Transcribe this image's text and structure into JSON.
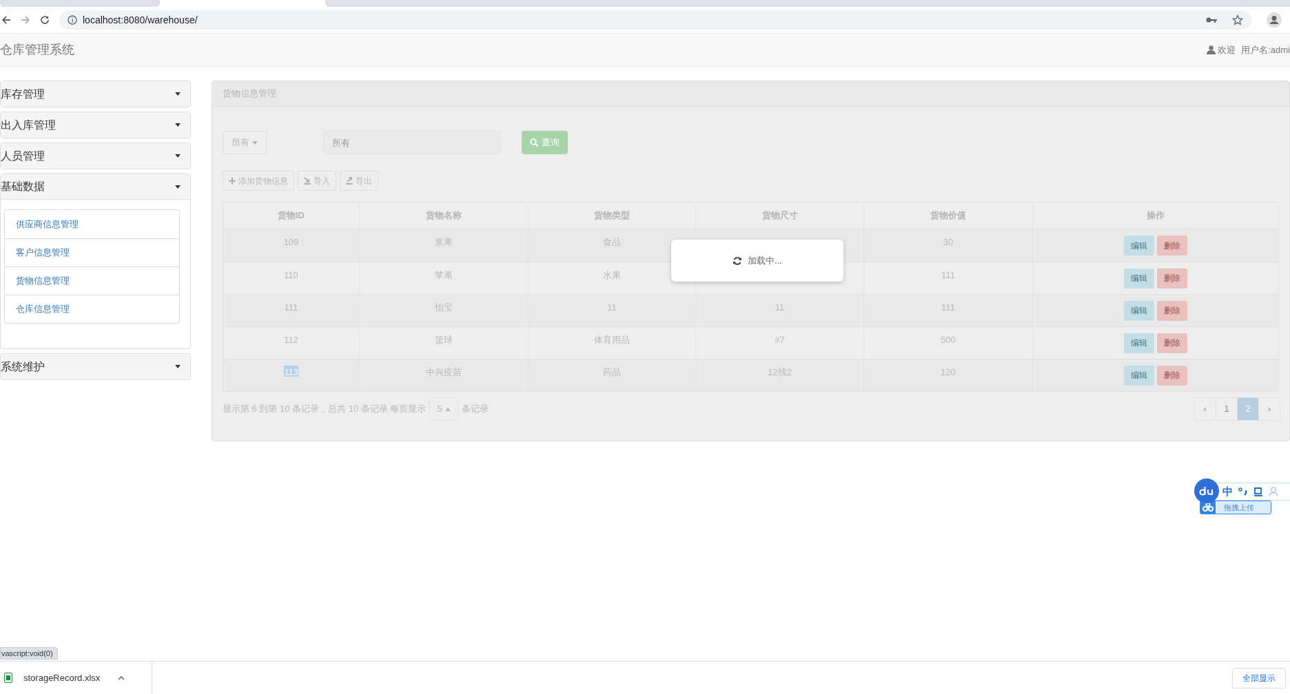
{
  "browser": {
    "url": "localhost:8080/warehouse/"
  },
  "header": {
    "title": "仓库管理系统",
    "welcome": "欢迎",
    "username": "用户名:admi"
  },
  "sidebar": [
    {
      "label": "库存管理",
      "expanded": false
    },
    {
      "label": "出入库管理",
      "expanded": false
    },
    {
      "label": "人员管理",
      "expanded": false
    },
    {
      "label": "基础数据",
      "expanded": true,
      "children": [
        {
          "label": "供应商信息管理"
        },
        {
          "label": "客户信息管理"
        },
        {
          "label": "货物信息管理"
        },
        {
          "label": "仓库信息管理"
        }
      ]
    },
    {
      "label": "系统维护",
      "expanded": false
    }
  ],
  "panel": {
    "title": "货物信息管理",
    "filter": "所有",
    "search": {
      "placeholder": "所有"
    },
    "query_button": "查询",
    "toolbar": [
      {
        "label": "添加货物信息",
        "kind": "add"
      },
      {
        "label": "导入",
        "kind": "import"
      },
      {
        "label": "导出",
        "kind": "export"
      }
    ],
    "columns": [
      "货物ID",
      "货物名称",
      "货物类型",
      "货物尺寸",
      "货物价值",
      "操作"
    ],
    "rows": [
      {
        "id": "109",
        "name": "浆果",
        "type": "食品",
        "value": "30",
        "id_selected": false,
        "actions": [
          {
            "label": "编辑",
            "kind": "edit"
          },
          {
            "label": "删除",
            "kind": "delete"
          }
        ]
      },
      {
        "id": "110",
        "name": "苹果",
        "type": "水果",
        "value": "111",
        "id_selected": false,
        "actions": [
          {
            "label": "编辑",
            "kind": "edit"
          },
          {
            "label": "删除",
            "kind": "delete"
          }
        ]
      },
      {
        "id": "111",
        "name": "怡宝",
        "type": "11",
        "size": "11",
        "value": "111",
        "id_selected": false,
        "actions": [
          {
            "label": "编辑",
            "kind": "edit"
          },
          {
            "label": "删除",
            "kind": "delete"
          }
        ]
      },
      {
        "id": "112",
        "name": "篮球",
        "type": "体育用品",
        "size": "#7",
        "value": "500",
        "id_selected": false,
        "actions": [
          {
            "label": "编辑",
            "kind": "edit"
          },
          {
            "label": "删除",
            "kind": "delete"
          }
        ]
      },
      {
        "id": "113",
        "name": "中兴疫苗",
        "type": "药品",
        "size": "12线2",
        "value": "120",
        "id_selected": true,
        "actions": [
          {
            "label": "编辑",
            "kind": "edit"
          },
          {
            "label": "删除",
            "kind": "delete"
          }
        ]
      }
    ],
    "pagination": {
      "info": "显示第 6 到第 10 条记录，总共 10 条记录 每页显示",
      "page_size": "5",
      "suffix": "条记录",
      "pages": [
        {
          "label": "‹",
          "selected": false
        },
        {
          "label": "1",
          "selected": false
        },
        {
          "label": "2",
          "selected": true
        },
        {
          "label": "›",
          "selected": false
        }
      ]
    },
    "loading": "加载中..."
  },
  "ime": {
    "mode": "中",
    "upload": "拖拽上传"
  },
  "status_url": "vascript:void(0)",
  "download": {
    "file": "storageRecord.xlsx",
    "show_all": "全部显示"
  }
}
